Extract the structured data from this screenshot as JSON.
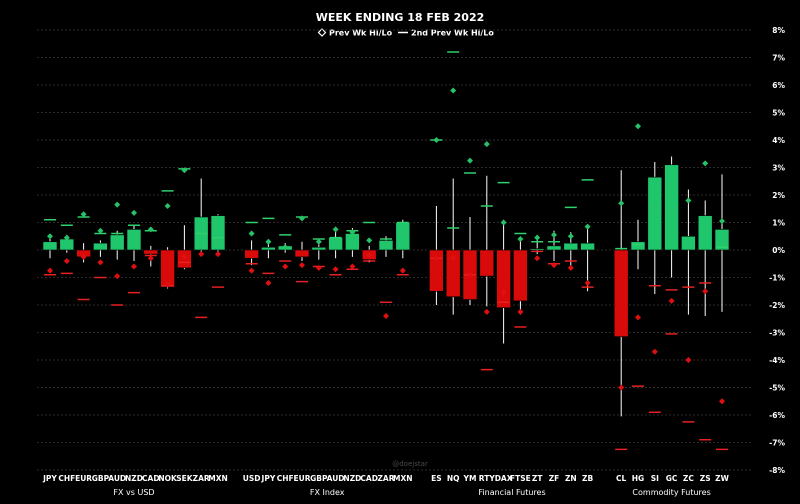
{
  "chart_data": {
    "type": "candlestick",
    "title": "WEEK ENDING 18 FEB 2022",
    "legend": [
      {
        "marker": "diamond",
        "label": "Prev Wk Hi/Lo"
      },
      {
        "marker": "dash",
        "label": "2nd Prev Wk Hi/Lo"
      }
    ],
    "y_axis": {
      "min": -8,
      "max": 8,
      "step": 1,
      "unit": "%",
      "side": "right"
    },
    "grid": true,
    "colors": {
      "up": "#1fc66b",
      "down": "#d90a0a",
      "prev": "#27c267",
      "prev_neg": "#e01010",
      "prev2_pos": "#2fd16c",
      "prev2_neg": "#e52121",
      "wick": "#ffffff",
      "grid": "#3a3a3a",
      "background": "#000000"
    },
    "watermark": "@doejstar",
    "groups": [
      {
        "name": "FX vs USD",
        "items": [
          {
            "label": "JPY",
            "open": 0,
            "close": 0.3,
            "high": 0.4,
            "low": -0.3,
            "prev_hi": 0.5,
            "prev_lo": -0.75,
            "prev2_hi": 1.1,
            "prev2_lo": -0.9
          },
          {
            "label": "CHF",
            "open": 0,
            "close": 0.4,
            "high": 0.55,
            "low": -0.1,
            "prev_hi": 0.45,
            "prev_lo": -0.4,
            "prev2_hi": 0.9,
            "prev2_lo": -0.85
          },
          {
            "label": "EUR",
            "open": 0,
            "close": -0.25,
            "high": 0.25,
            "low": -0.45,
            "prev_hi": 1.3,
            "prev_lo": -0.25,
            "prev2_hi": 1.2,
            "prev2_lo": -1.8
          },
          {
            "label": "GBP",
            "open": 0,
            "close": 0.25,
            "high": 0.35,
            "low": -0.25,
            "prev_hi": 0.7,
            "prev_lo": -0.45,
            "prev2_hi": 0.6,
            "prev2_lo": -1.0
          },
          {
            "label": "AUD",
            "open": 0,
            "close": 0.55,
            "high": 0.7,
            "low": -0.35,
            "prev_hi": 1.65,
            "prev_lo": -0.95,
            "prev2_hi": 0.6,
            "prev2_lo": -2.0
          },
          {
            "label": "NZD",
            "open": 0,
            "close": 0.75,
            "high": 0.9,
            "low": -0.4,
            "prev_hi": 1.35,
            "prev_lo": -0.6,
            "prev2_hi": 0.9,
            "prev2_lo": -1.55
          },
          {
            "label": "CAD",
            "open": 0,
            "close": -0.15,
            "high": 0.15,
            "low": -0.6,
            "prev_hi": 0.75,
            "prev_lo": -0.3,
            "prev2_hi": 0.7,
            "prev2_lo": -0.2
          },
          {
            "label": "NOK",
            "open": 0,
            "close": -1.35,
            "high": 0.1,
            "low": -1.4,
            "prev_hi": 1.6,
            "prev_lo": -1.25,
            "prev2_hi": 2.15,
            "prev2_lo": -1.3
          },
          {
            "label": "SEK",
            "open": 0,
            "close": -0.65,
            "high": 0.9,
            "low": -0.7,
            "prev_hi": 2.9,
            "prev_lo": -0.25,
            "prev2_hi": 2.95,
            "prev2_lo": -0.45
          },
          {
            "label": "ZAR",
            "open": 0,
            "close": 1.2,
            "high": 2.6,
            "low": -0.1,
            "prev_hi": 0.15,
            "prev_lo": -0.15,
            "prev2_hi": 0.6,
            "prev2_lo": -2.45
          },
          {
            "label": "MXN",
            "open": 0,
            "close": 1.25,
            "high": 1.3,
            "low": -0.1,
            "prev_hi": 0.35,
            "prev_lo": -0.15,
            "prev2_hi": 0.45,
            "prev2_lo": -1.35
          }
        ]
      },
      {
        "name": "FX Index",
        "items": [
          {
            "label": "USD",
            "open": 0,
            "close": -0.3,
            "high": 0.35,
            "low": -0.55,
            "prev_hi": 0.6,
            "prev_lo": -0.75,
            "prev2_hi": 1.0,
            "prev2_lo": -0.5
          },
          {
            "label": "JPY",
            "open": 0,
            "close": 0.1,
            "high": 0.3,
            "low": -0.3,
            "prev_hi": 0.3,
            "prev_lo": -1.2,
            "prev2_hi": 1.15,
            "prev2_lo": -0.85
          },
          {
            "label": "CHF",
            "open": 0,
            "close": 0.15,
            "high": 0.25,
            "low": -0.1,
            "prev_hi": 0.1,
            "prev_lo": -0.6,
            "prev2_hi": 0.55,
            "prev2_lo": -0.4
          },
          {
            "label": "EUR",
            "open": 0,
            "close": -0.25,
            "high": 0.3,
            "low": -0.4,
            "prev_hi": 1.15,
            "prev_lo": -0.55,
            "prev2_hi": 1.2,
            "prev2_lo": -1.15
          },
          {
            "label": "GBP",
            "open": 0,
            "close": 0.1,
            "high": 0.2,
            "low": -0.35,
            "prev_hi": 0.3,
            "prev_lo": -0.65,
            "prev2_hi": 0.4,
            "prev2_lo": -0.6
          },
          {
            "label": "AUD",
            "open": 0,
            "close": 0.45,
            "high": 0.65,
            "low": -0.3,
            "prev_hi": 0.75,
            "prev_lo": -0.7,
            "prev2_hi": 0.45,
            "prev2_lo": -0.9
          },
          {
            "label": "NZD",
            "open": 0,
            "close": 0.6,
            "high": 0.8,
            "low": -0.25,
            "prev_hi": 0.65,
            "prev_lo": -0.6,
            "prev2_hi": 0.7,
            "prev2_lo": -0.7
          },
          {
            "label": "CAD",
            "open": 0,
            "close": -0.35,
            "high": 0.15,
            "low": -0.45,
            "prev_hi": 0.35,
            "prev_lo": -0.2,
            "prev2_hi": 1.0,
            "prev2_lo": -0.4
          },
          {
            "label": "ZAR",
            "open": 0,
            "close": 0.35,
            "high": 0.5,
            "low": -0.25,
            "prev_hi": 0.25,
            "prev_lo": -2.4,
            "prev2_hi": 0.4,
            "prev2_lo": -1.9
          },
          {
            "label": "MXN",
            "open": 0,
            "close": 1.0,
            "high": 1.1,
            "low": -0.3,
            "prev_hi": 0.65,
            "prev_lo": -0.75,
            "prev2_hi": 1.0,
            "prev2_lo": -0.9
          }
        ]
      },
      {
        "name": "Financial Futures",
        "items": [
          {
            "label": "ES",
            "open": 0,
            "close": -1.5,
            "high": 1.6,
            "low": -2.0,
            "prev_hi": 4.0,
            "prev_lo": -0.3,
            "prev2_hi": 4.0,
            "prev2_lo": -0.3
          },
          {
            "label": "NQ",
            "open": 0,
            "close": -1.7,
            "high": 2.6,
            "low": -2.35,
            "prev_hi": 5.8,
            "prev_lo": -0.3,
            "prev2_hi": 7.2,
            "prev2_lo": 0.8
          },
          {
            "label": "YM",
            "open": 0,
            "close": -1.8,
            "high": 1.2,
            "low": -2.0,
            "prev_hi": 3.25,
            "prev_lo": -0.9,
            "prev2_hi": 2.8,
            "prev2_lo": -0.9
          },
          {
            "label": "RTY",
            "open": 0,
            "close": -0.95,
            "high": 2.7,
            "low": -2.05,
            "prev_hi": 3.85,
            "prev_lo": -2.25,
            "prev2_hi": 1.6,
            "prev2_lo": -4.35
          },
          {
            "label": "DAX",
            "open": 0,
            "close": -2.1,
            "high": 1.1,
            "low": -3.4,
            "prev_hi": 1.0,
            "prev_lo": -1.55,
            "prev2_hi": 2.45,
            "prev2_lo": -1.9
          },
          {
            "label": "FTSE",
            "open": 0,
            "close": -1.85,
            "high": 0.4,
            "low": -2.35,
            "prev_hi": 0.4,
            "prev_lo": -2.25,
            "prev2_hi": 0.6,
            "prev2_lo": -2.8
          },
          {
            "label": "ZT",
            "open": 0,
            "close": 0.05,
            "high": 0.55,
            "low": -0.15,
            "prev_hi": 0.45,
            "prev_lo": -0.3,
            "prev2_hi": 0.3,
            "prev2_lo": -0.05
          },
          {
            "label": "ZF",
            "open": 0,
            "close": 0.15,
            "high": 0.7,
            "low": -0.4,
            "prev_hi": 0.55,
            "prev_lo": -0.55,
            "prev2_hi": 0.3,
            "prev2_lo": -0.5
          },
          {
            "label": "ZN",
            "open": 0,
            "close": 0.25,
            "high": 0.65,
            "low": -0.6,
            "prev_hi": 0.5,
            "prev_lo": -0.65,
            "prev2_hi": 1.55,
            "prev2_lo": -0.4
          },
          {
            "label": "ZB",
            "open": 0,
            "close": 0.25,
            "high": 0.8,
            "low": -1.5,
            "prev_hi": 0.85,
            "prev_lo": -1.2,
            "prev2_hi": 2.55,
            "prev2_lo": -1.35
          }
        ]
      },
      {
        "name": "Commodity Futures",
        "items": [
          {
            "label": "CL",
            "open": 0,
            "close": -3.15,
            "high": 2.9,
            "low": -6.05,
            "prev_hi": 1.7,
            "prev_lo": -5.0,
            "prev2_hi": 0.05,
            "prev2_lo": -7.25
          },
          {
            "label": "HG",
            "open": 0,
            "close": 0.3,
            "high": 1.1,
            "low": -0.7,
            "prev_hi": 4.5,
            "prev_lo": -2.45,
            "prev2_hi": 0.2,
            "prev2_lo": -4.95
          },
          {
            "label": "SI",
            "open": 0,
            "close": 2.65,
            "high": 3.2,
            "low": -1.6,
            "prev_hi": 1.6,
            "prev_lo": -3.7,
            "prev2_hi": -1.3,
            "prev2_lo": -5.9
          },
          {
            "label": "GC",
            "open": 0,
            "close": 3.1,
            "high": 3.4,
            "low": -1.0,
            "prev_hi": 1.35,
            "prev_lo": -1.85,
            "prev2_hi": -1.45,
            "prev2_lo": -3.05
          },
          {
            "label": "ZC",
            "open": 0,
            "close": 0.5,
            "high": 2.2,
            "low": -2.35,
            "prev_hi": 1.8,
            "prev_lo": -4.0,
            "prev2_hi": -1.35,
            "prev2_lo": -6.25
          },
          {
            "label": "ZS",
            "open": 0,
            "close": 1.25,
            "high": 1.8,
            "low": -2.4,
            "prev_hi": 3.15,
            "prev_lo": -1.5,
            "prev2_hi": -1.2,
            "prev2_lo": -6.9
          },
          {
            "label": "ZW",
            "open": 0,
            "close": 0.75,
            "high": 2.75,
            "low": -2.25,
            "prev_hi": 1.05,
            "prev_lo": -5.5,
            "prev2_hi": 0.1,
            "prev2_lo": -7.25
          }
        ]
      }
    ]
  }
}
